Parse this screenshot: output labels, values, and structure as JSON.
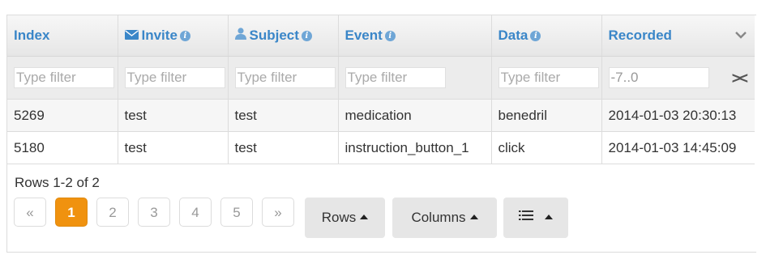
{
  "columns": [
    {
      "label": "Index",
      "icon": null,
      "info": false
    },
    {
      "label": "Invite",
      "icon": "envelope-icon",
      "info": true
    },
    {
      "label": "Subject",
      "icon": "user-icon",
      "info": true
    },
    {
      "label": "Event",
      "icon": null,
      "info": true
    },
    {
      "label": "Data",
      "icon": null,
      "info": true
    },
    {
      "label": "Recorded",
      "icon": null,
      "info": false
    }
  ],
  "filters": [
    {
      "placeholder": "Type filter",
      "value": ""
    },
    {
      "placeholder": "Type filter",
      "value": ""
    },
    {
      "placeholder": "Type filter",
      "value": ""
    },
    {
      "placeholder": "Type filter",
      "value": ""
    },
    {
      "placeholder": "Type filter",
      "value": ""
    },
    {
      "placeholder": "",
      "value": "-7..0"
    }
  ],
  "rows": [
    [
      "5269",
      "test",
      "test",
      "medication",
      "benedril",
      "2014-01-03 20:30:13"
    ],
    [
      "5180",
      "test",
      "test",
      "instruction_button_1",
      "click",
      "2014-01-03 14:45:09"
    ]
  ],
  "footer": {
    "rows_summary": "Rows 1-2 of 2",
    "pagination": {
      "prev": "«",
      "pages": [
        "1",
        "2",
        "3",
        "4",
        "5"
      ],
      "next": "»",
      "active": "1"
    },
    "buttons": {
      "rows": "Rows",
      "columns": "Columns"
    }
  },
  "colors": {
    "header_text": "#3a86c8",
    "active_page": "#f0920f",
    "info_icon": "#6fa6d6"
  }
}
